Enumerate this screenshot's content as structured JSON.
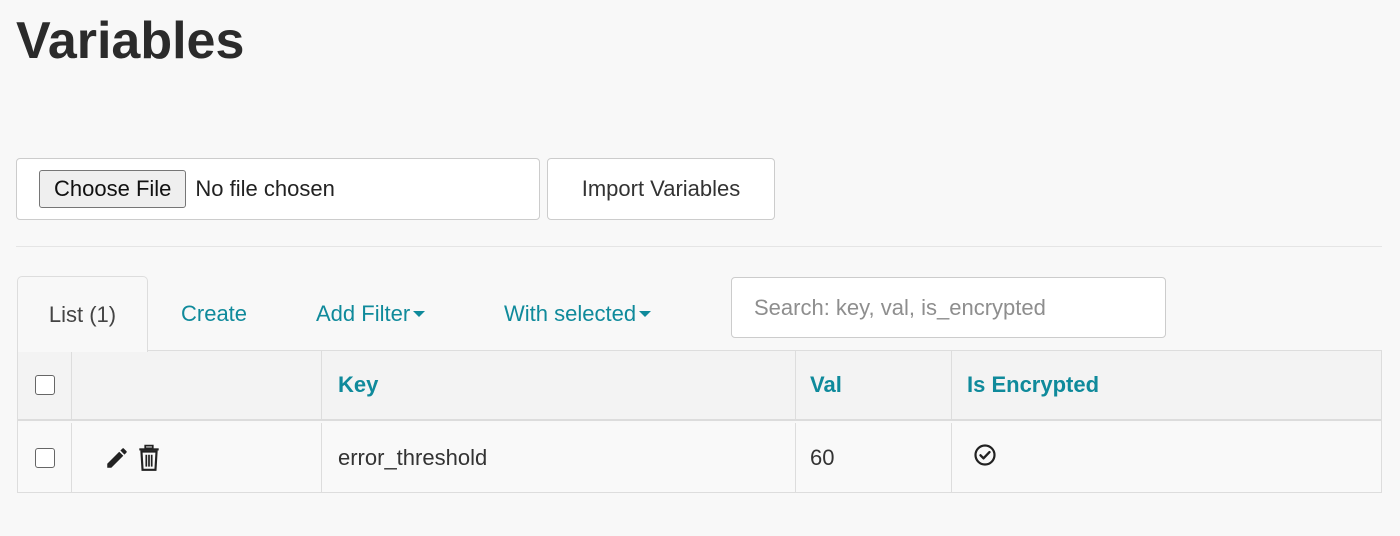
{
  "page": {
    "title": "Variables"
  },
  "import": {
    "choose_file_label": "Choose File",
    "file_status": "No file chosen",
    "import_button_label": "Import Variables"
  },
  "tabs": {
    "list_label": "List (1)",
    "create_label": "Create",
    "add_filter_label": "Add Filter",
    "with_selected_label": "With selected"
  },
  "search": {
    "placeholder": "Search: key, val, is_encrypted"
  },
  "table": {
    "columns": [
      "Key",
      "Val",
      "Is Encrypted"
    ],
    "rows": [
      {
        "key": "error_threshold",
        "val": "60",
        "is_encrypted": true
      }
    ]
  },
  "icons": {
    "edit": "pencil-icon",
    "delete": "trash-icon",
    "encrypted": "check-circle-icon"
  },
  "colors": {
    "accent": "#0f8a9b",
    "background": "#f8f8f8"
  }
}
